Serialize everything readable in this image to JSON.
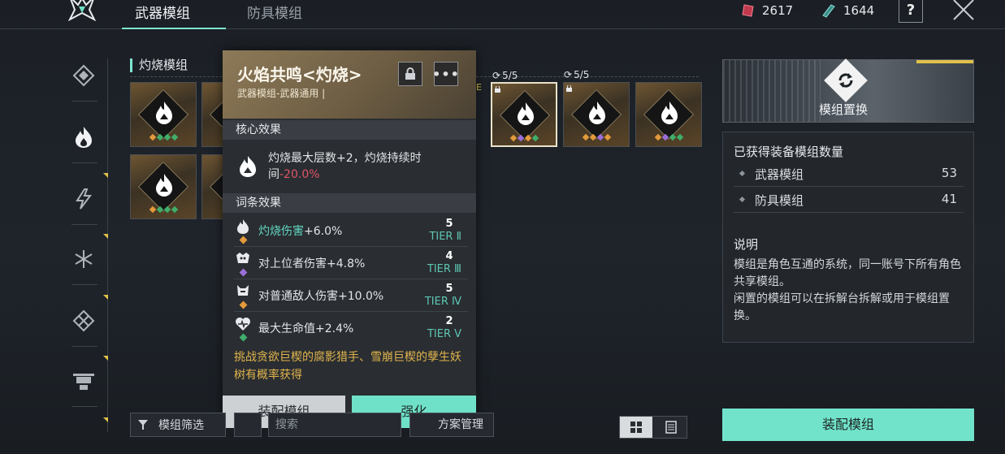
{
  "topbar": {
    "tabs": [
      {
        "label": "武器模组"
      },
      {
        "label": "防具模组"
      }
    ],
    "currency": [
      {
        "icon": "red-crystal-icon",
        "value": "2617"
      },
      {
        "icon": "teal-crystal-icon",
        "value": "1644"
      }
    ],
    "help_label": "?"
  },
  "section": {
    "title": "灼烧模组"
  },
  "cards": [
    {
      "cap": ""
    },
    {
      "cap": ""
    },
    {
      "cap": "E"
    },
    {
      "cap": "5/5"
    },
    {
      "cap": "5/5"
    },
    {
      "cap": ""
    }
  ],
  "popup": {
    "title": "火焰共鸣<灼烧>",
    "subtitle": "武器模组-武器通用 |",
    "more_label": "•••",
    "core_header": "核心效果",
    "core_text_a": "灼烧最大层数+2，灼烧持续时间",
    "core_text_b": "-20.0%",
    "affix_header": "词条效果",
    "affixes": [
      {
        "name_hl": "灼烧伤害",
        "name": "+6.0%",
        "level": "5",
        "tier": "TIER Ⅱ",
        "color": "#e39a3c"
      },
      {
        "name_hl": "",
        "name": "对上位者伤害+4.8%",
        "level": "4",
        "tier": "TIER Ⅲ",
        "color": "#9a6ed8"
      },
      {
        "name_hl": "",
        "name": "对普通敌人伤害+10.0%",
        "level": "5",
        "tier": "TIER Ⅳ",
        "color": "#e39a3c"
      },
      {
        "name_hl": "",
        "name": "最大生命值+2.4%",
        "level": "2",
        "tier": "TIER Ⅴ",
        "color": "#3fae6a"
      }
    ],
    "source": "挑战贪欲巨楔的腐影猎手、雪崩巨楔的孽生妖树有概率获得",
    "equip_label": "装配模组",
    "enhance_label": "强化"
  },
  "bottombar": {
    "filter_label": "模组筛选",
    "search_placeholder": "搜索",
    "manage_label": "方案管理"
  },
  "right": {
    "banner_title": "模组置换",
    "owned_header": "已获得装备模组数量",
    "owned": [
      {
        "label": "武器模组",
        "value": "53"
      },
      {
        "label": "防具模组",
        "value": "41"
      }
    ],
    "desc_header": "说明",
    "desc_line1": "模组是角色互通的系统，同一账号下所有角色共享模组。",
    "desc_line2": "闲置的模组可以在拆解台拆解或用于模组置换。",
    "equip_label": "装配模组"
  },
  "colors": {
    "accent": "#6fe1c8",
    "gold": "#e1b54d",
    "red": "#e0556a"
  }
}
